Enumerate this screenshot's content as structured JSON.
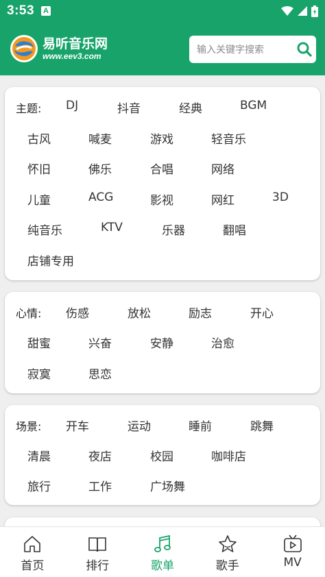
{
  "status_bar": {
    "time": "3:53",
    "notification_letter": "A"
  },
  "header": {
    "logo_title": "易听音乐网",
    "logo_url": "www.eev3.com",
    "search_placeholder": "输入关键字搜索"
  },
  "categories": [
    {
      "label": "主题:",
      "tags": [
        "DJ",
        "抖音",
        "经典",
        "BGM",
        "古风",
        "喊麦",
        "游戏",
        "轻音乐",
        "怀旧",
        "佛乐",
        "合唱",
        "网络",
        "儿童",
        "ACG",
        "影视",
        "网红",
        "3D",
        "纯音乐",
        "KTV",
        "乐器",
        "翻唱",
        "店铺专用"
      ]
    },
    {
      "label": "心情:",
      "tags": [
        "伤感",
        "放松",
        "励志",
        "开心",
        "甜蜜",
        "兴奋",
        "安静",
        "治愈",
        "寂寞",
        "思恋"
      ]
    },
    {
      "label": "场景:",
      "tags": [
        "开车",
        "运动",
        "睡前",
        "跳舞",
        "清晨",
        "夜店",
        "校园",
        "咖啡店",
        "旅行",
        "工作",
        "广场舞"
      ]
    }
  ],
  "bottom_nav": [
    {
      "label": "首页",
      "icon": "home-icon",
      "active": false
    },
    {
      "label": "排行",
      "icon": "book-icon",
      "active": false
    },
    {
      "label": "歌单",
      "icon": "music-note-icon",
      "active": true
    },
    {
      "label": "歌手",
      "icon": "star-icon",
      "active": false
    },
    {
      "label": "MV",
      "icon": "tv-icon",
      "active": false
    }
  ],
  "colors": {
    "brand": "#18a36a",
    "card_bg": "#ffffff",
    "text": "#333333"
  }
}
